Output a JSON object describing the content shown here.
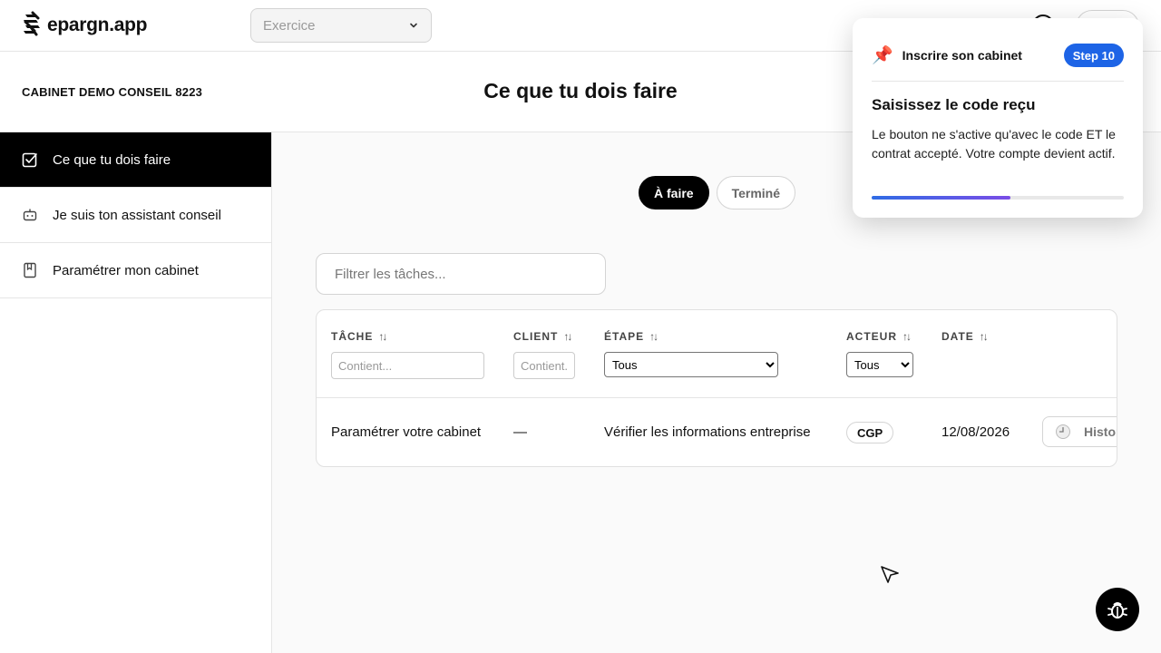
{
  "app": {
    "logo_text": "epargn.app"
  },
  "topbar": {
    "exercice_placeholder": "Exercice"
  },
  "header": {
    "cabinet_name": "CABINET DEMO CONSEIL 8223",
    "page_title": "Ce que tu dois faire"
  },
  "sidebar": {
    "items": [
      {
        "label": "Ce que tu dois faire",
        "icon": "checkbox-icon",
        "active": true
      },
      {
        "label": "Je suis ton assistant conseil",
        "icon": "robot-icon",
        "active": false
      },
      {
        "label": "Paramétrer mon cabinet",
        "icon": "bookmark-book-icon",
        "active": false
      }
    ]
  },
  "tabs": [
    {
      "label": "À faire",
      "active": true
    },
    {
      "label": "Terminé",
      "active": false
    }
  ],
  "filter": {
    "placeholder": "Filtrer les tâches..."
  },
  "table": {
    "columns": {
      "tache": "TÂCHE",
      "client": "CLIENT",
      "etape": "ÉTAPE",
      "acteur": "ACTEUR",
      "date": "DATE"
    },
    "column_filters": {
      "tache_placeholder": "Contient...",
      "client_placeholder": "Contient...",
      "etape_selected": "Tous",
      "acteur_selected": "Tous"
    },
    "rows": [
      {
        "tache": "Paramétrer votre cabinet",
        "client": "—",
        "etape": "Vérifier les informations entreprise",
        "acteur": "CGP",
        "date": "12/08/2026",
        "action": "Histor"
      }
    ]
  },
  "popover": {
    "header_title": "Inscrire son cabinet",
    "step_badge": "Step 10",
    "title": "Saisissez le code reçu",
    "body": "Le bouton ne s'active qu'avec le code ET le contrat accepté. Votre compte devient actif.",
    "progress": 0.55,
    "progress_colors": [
      "#2f6ce5",
      "#7a4de6"
    ]
  },
  "colors": {
    "accent": "#1d64e6",
    "active_nav": "#000000"
  }
}
